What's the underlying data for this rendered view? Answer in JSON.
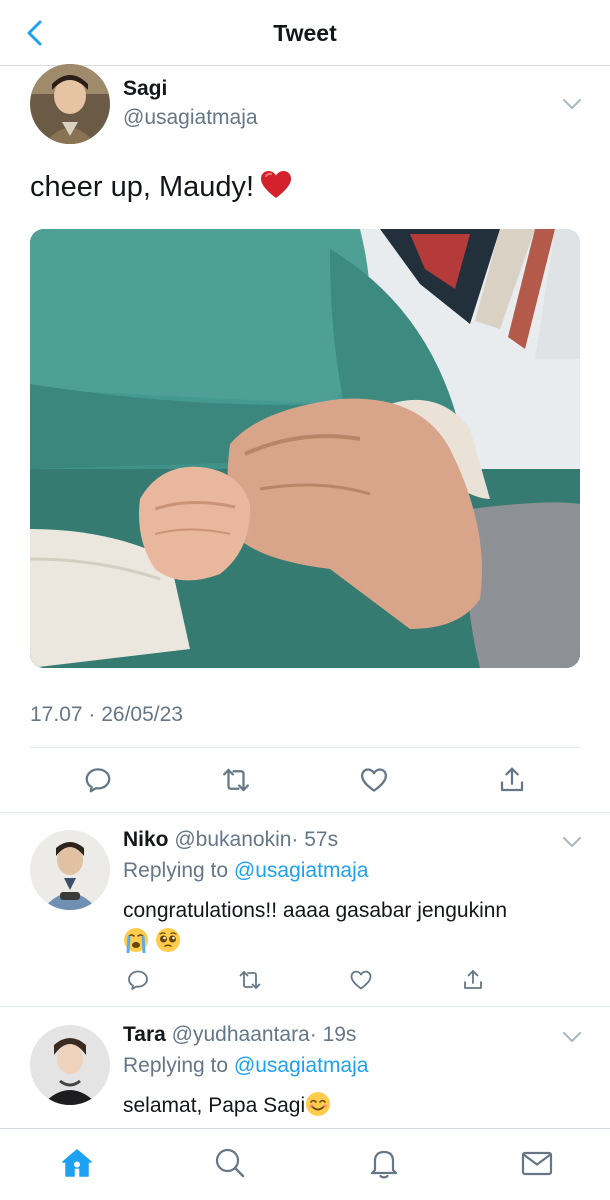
{
  "header": {
    "title": "Tweet"
  },
  "tweet": {
    "author_name": "Sagi",
    "author_handle": "@usagiatmaja",
    "text": "cheer up, Maudy!",
    "text_emoji": "red-heart",
    "timestamp": "17.07 · 26/05/23",
    "actions": [
      "reply-icon",
      "retweet-icon",
      "like-icon",
      "share-icon"
    ]
  },
  "replies": [
    {
      "name": "Niko",
      "handle": "@bukanokin",
      "time": "· 57s",
      "replying_prefix": "Replying to",
      "replying_to": "@usagiatmaja",
      "text_line1": "congratulations!! aaaa gasabar jengukinn",
      "emojis": [
        "loudly-crying-face",
        "pleading-face"
      ]
    },
    {
      "name": "Tara",
      "handle": "@yudhaantara",
      "time": "· 19s",
      "replying_prefix": "Replying to",
      "replying_to": "@usagiatmaja",
      "text_line1": "selamat, Papa Sagi",
      "emojis": [
        "smiling-face-with-smiling-eyes"
      ]
    }
  ],
  "tabbar": [
    "home-icon",
    "search-icon",
    "notifications-icon",
    "messages-icon"
  ],
  "colors": {
    "accent": "#1da1f2",
    "secondary_text": "#657786",
    "divider": "#e1e8ed"
  }
}
